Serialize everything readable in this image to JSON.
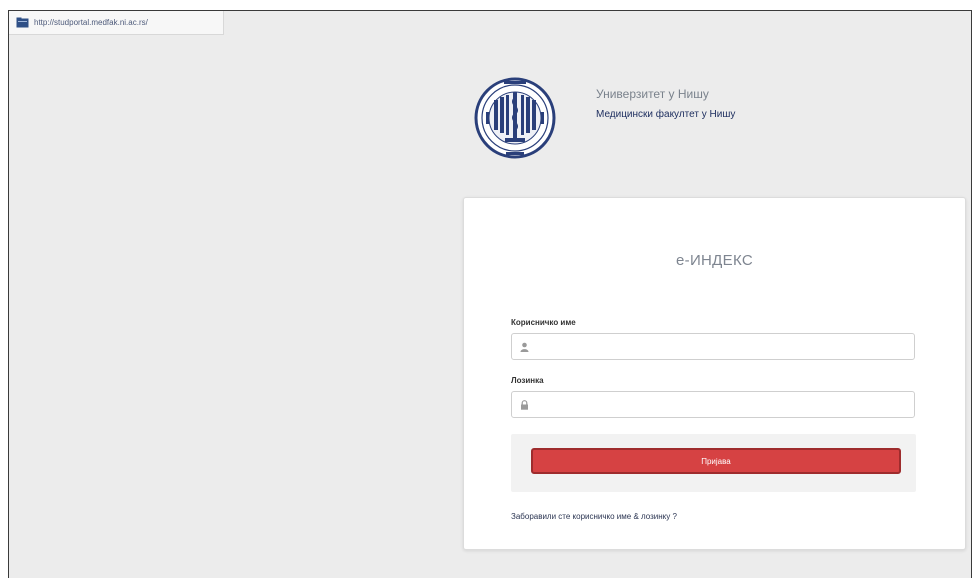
{
  "browser": {
    "url": "http://studportal.medfak.ni.ac.rs/"
  },
  "header": {
    "university": "Универзитет у Нишу",
    "faculty": "Медицински факултет у Нишу"
  },
  "login": {
    "title": "е-ИНДЕКС",
    "username_label": "Корисничко име",
    "username_value": "",
    "password_label": "Лозинка",
    "password_value": "",
    "submit_label": "Пријава",
    "forgot_link": "Заборавили сте корисничко име & лозинку ?"
  },
  "icons": {
    "url": "page-icon",
    "username": "user-icon",
    "password": "lock-icon"
  },
  "colors": {
    "background": "#ececec",
    "card": "#ffffff",
    "button": "#d64243",
    "button_border": "#9e2c2d",
    "faculty_text": "#1c2d5e"
  }
}
